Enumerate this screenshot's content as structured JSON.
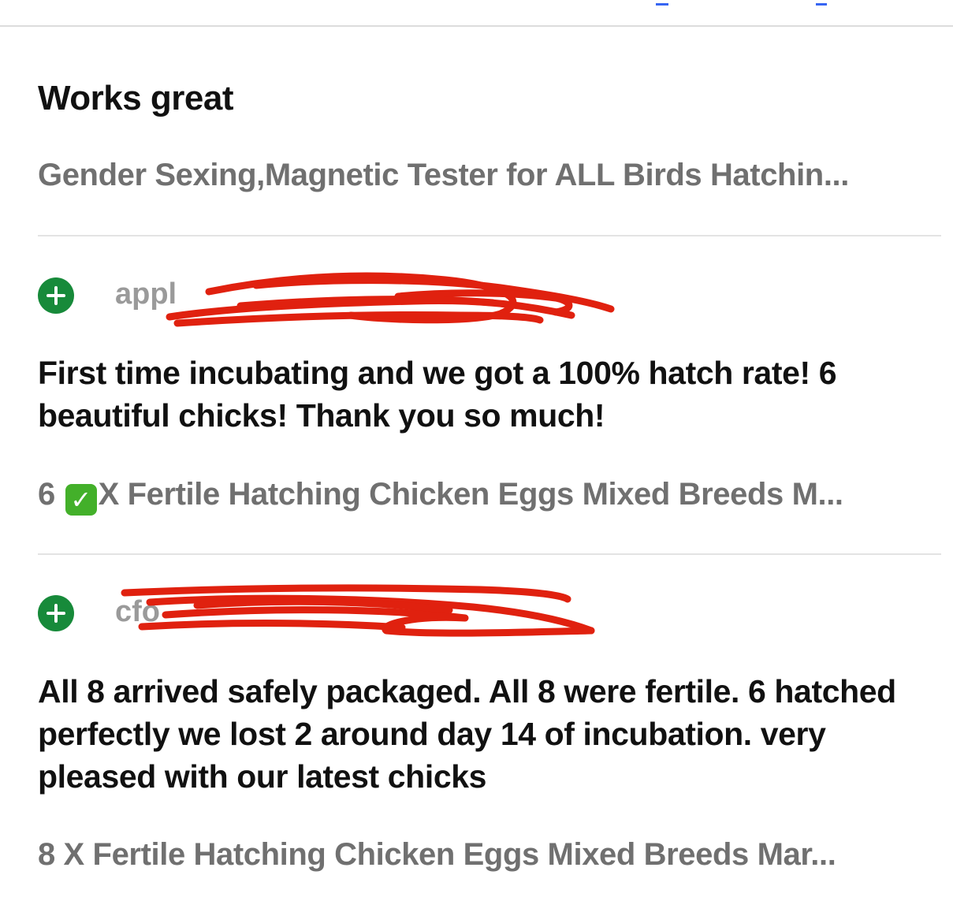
{
  "reviews": [
    {
      "title": "Works great",
      "item_title": "Gender Sexing,Magnetic Tester for ALL Birds Hatchin..."
    },
    {
      "reviewer": "appl",
      "body": "First time incubating and we got a 100% hatch rate! 6 beautiful chicks! Thank you so much!",
      "item_prefix": "6",
      "item_emoji": "✓",
      "item_title": "X Fertile Hatching Chicken Eggs Mixed Breeds M..."
    },
    {
      "reviewer": "cfo",
      "body": "All 8 arrived safely packaged. All 8 were fertile. 6 hatched perfectly we lost 2 around day 14 of incubation. very pleased with our latest chicks",
      "item_title": "8 X  Fertile Hatching Chicken Eggs Mixed Breeds Mar..."
    }
  ],
  "colors": {
    "expand_button": "#178a3a",
    "redaction_scribble": "#e0210f",
    "secondary_text": "#707070",
    "accent_blue": "#3665f3"
  }
}
